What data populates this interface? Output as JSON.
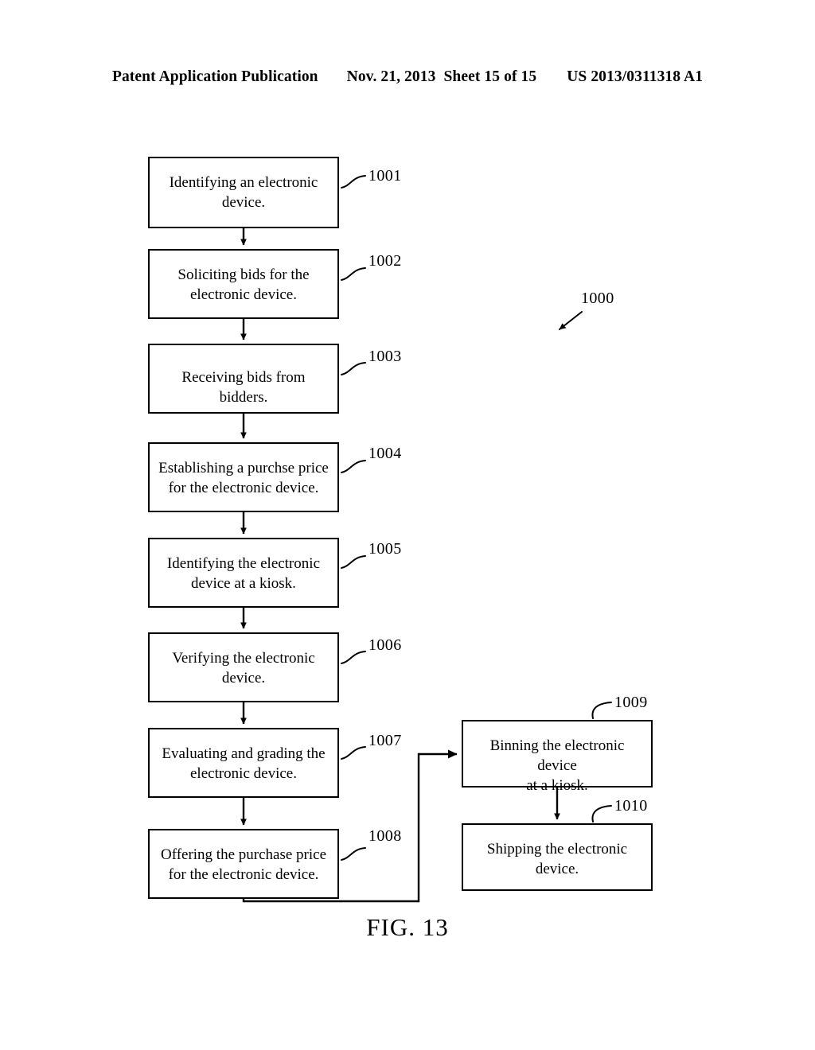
{
  "header": {
    "publication": "Patent Application Publication",
    "date": "Nov. 21, 2013",
    "sheet": "Sheet 15 of 15",
    "patent_number": "US 2013/0311318 A1"
  },
  "figure": {
    "caption": "FIG. 13",
    "overall_ref": "1000",
    "line_color": "#000000",
    "background": "#ffffff"
  },
  "flowchart": {
    "left_column": [
      {
        "ref": "1001",
        "text": "Identifying an electronic\ndevice."
      },
      {
        "ref": "1002",
        "text": "Soliciting bids for the\nelectronic device."
      },
      {
        "ref": "1003",
        "text": "Receiving bids from bidders."
      },
      {
        "ref": "1004",
        "text": "Establishing a purchse price\nfor the electronic device."
      },
      {
        "ref": "1005",
        "text": "Identifying the electronic\ndevice at a kiosk."
      },
      {
        "ref": "1006",
        "text": "Verifying the electronic\ndevice."
      },
      {
        "ref": "1007",
        "text": "Evaluating and grading the\nelectronic device."
      },
      {
        "ref": "1008",
        "text": "Offering the purchase price\nfor the electronic device."
      }
    ],
    "right_column": [
      {
        "ref": "1009",
        "text": "Binning the electronic device\nat a kiosk."
      },
      {
        "ref": "1010",
        "text": "Shipping the electronic\ndevice."
      }
    ]
  }
}
